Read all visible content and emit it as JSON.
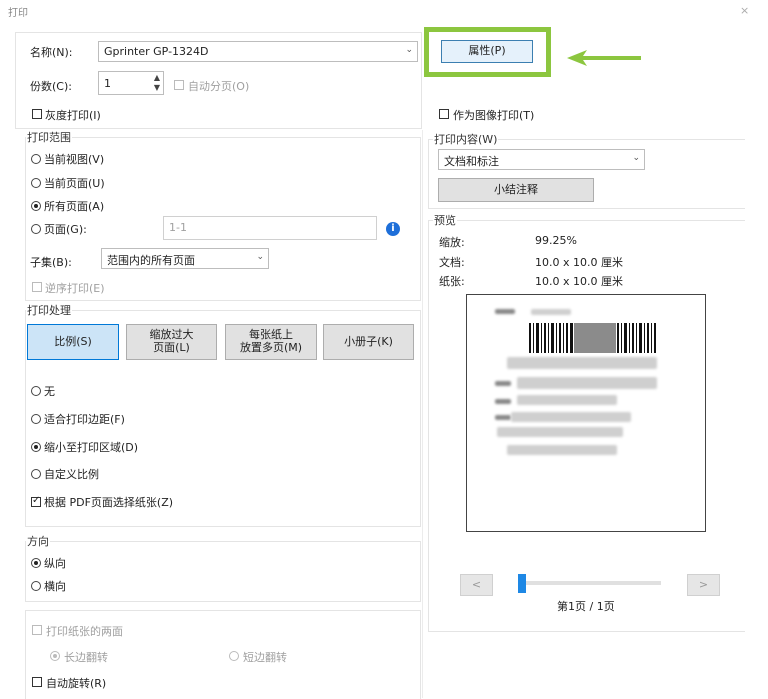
{
  "window": {
    "title": "打印",
    "close": "×"
  },
  "printer": {
    "name_label": "名称(N):",
    "name_value": "Gprinter GP-1324D",
    "properties_button": "属性(P)",
    "copies_label": "份数(C):",
    "copies_value": "1",
    "collate_label": "自动分页(O)",
    "grayscale_label": "灰度打印(I)",
    "print_as_image_label": "作为图像打印(T)"
  },
  "print_range": {
    "title": "打印范围",
    "current_view": "当前视图(V)",
    "current_page": "当前页面(U)",
    "all_pages": "所有页面(A)",
    "pages_label": "页面(G):",
    "pages_value": "1-1",
    "info_icon": "i",
    "subset_label": "子集(B):",
    "subset_value": "范围内的所有页面",
    "reverse_label": "逆序打印(E)",
    "selected": "all_pages"
  },
  "print_handling": {
    "title": "打印处理",
    "tabs": [
      "比例(S)",
      "缩放过大\n页面(L)",
      "每张纸上\n放置多页(M)",
      "小册子(K)"
    ],
    "active_tab": 0,
    "none": "无",
    "fit_margins": "适合打印边距(F)",
    "shrink_area": "缩小至打印区域(D)",
    "custom_scale": "自定义比例",
    "choose_paper_by_pdf": "根据 PDF页面选择纸张(Z)",
    "selected": "shrink_area",
    "choose_paper_checked": true
  },
  "orientation": {
    "title": "方向",
    "portrait": "纵向",
    "landscape": "横向",
    "selected": "portrait"
  },
  "duplex": {
    "both_sides": "打印纸张的两面",
    "long_edge": "长边翻转",
    "short_edge": "短边翻转",
    "auto_rotate": "自动旋转(R)"
  },
  "content": {
    "title": "打印内容(W)",
    "value": "文档和标注",
    "summarize_button": "小结注释"
  },
  "preview": {
    "title": "预览",
    "zoom_label": "缩放:",
    "zoom_value": "99.25%",
    "doc_label": "文档:",
    "doc_value": "10.0 x 10.0 厘米",
    "paper_label": "纸张:",
    "paper_value": "10.0 x 10.0 厘米",
    "prev": "<",
    "next": ">",
    "page_indicator": "第1页 / 1页",
    "slider_level": 0
  },
  "colors": {
    "highlight": "#8cc63f",
    "accent": "#1e88e5"
  }
}
